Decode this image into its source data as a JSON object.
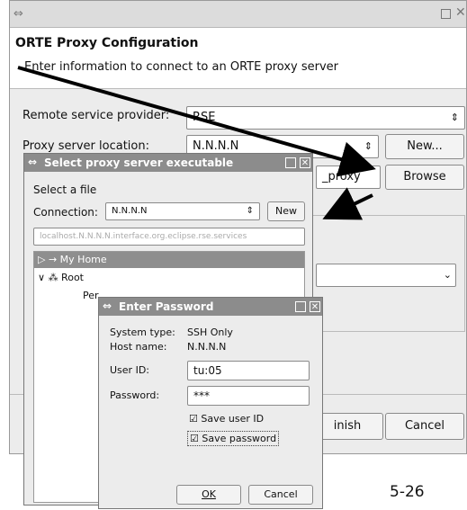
{
  "main_window": {
    "title_icon": "window-menu-icon",
    "heading": "ORTE Proxy Configuration",
    "subheading": "Enter information to connect to an ORTE proxy server",
    "remote_provider_label": "Remote service provider:",
    "remote_provider_value": "RSE",
    "proxy_location_label": "Proxy server location:",
    "proxy_location_value": "N.N.N.N",
    "new_button": "New...",
    "executable_value": "_proxy",
    "browse_button": "Browse",
    "combo_value": "",
    "finish_button": "inish",
    "cancel_button": "Cancel"
  },
  "select_dialog": {
    "title": "Select proxy server executable",
    "select_file_label": "Select a file",
    "connection_label": "Connection:",
    "connection_value": "N.N.N.N",
    "new_button": "New",
    "path_value": "localhost.N.N.N.N.interface.org.eclipse.rse.services",
    "tree": [
      {
        "label": "→ My Home",
        "selected": true
      },
      {
        "label": "⁂ Root",
        "selected": false
      },
      {
        "label": "Per",
        "selected": false
      }
    ]
  },
  "password_dialog": {
    "title": "Enter Password",
    "system_type_label": "System type:",
    "system_type_value": "SSH Only",
    "host_name_label": "Host name:",
    "host_name_value": "N.N.N.N",
    "user_id_label": "User ID:",
    "user_id_value": "tu:05",
    "password_label": "Password:",
    "password_value": "***",
    "save_user_id_label": "Save user ID",
    "save_password_label": "Save password",
    "ok_button": "OK",
    "cancel_button": "Cancel"
  },
  "page_number": "5-26",
  "colors": {
    "title_grey": "#8c8c8c",
    "selected_row": "#8e8e8e",
    "window_bg": "#ececec"
  }
}
